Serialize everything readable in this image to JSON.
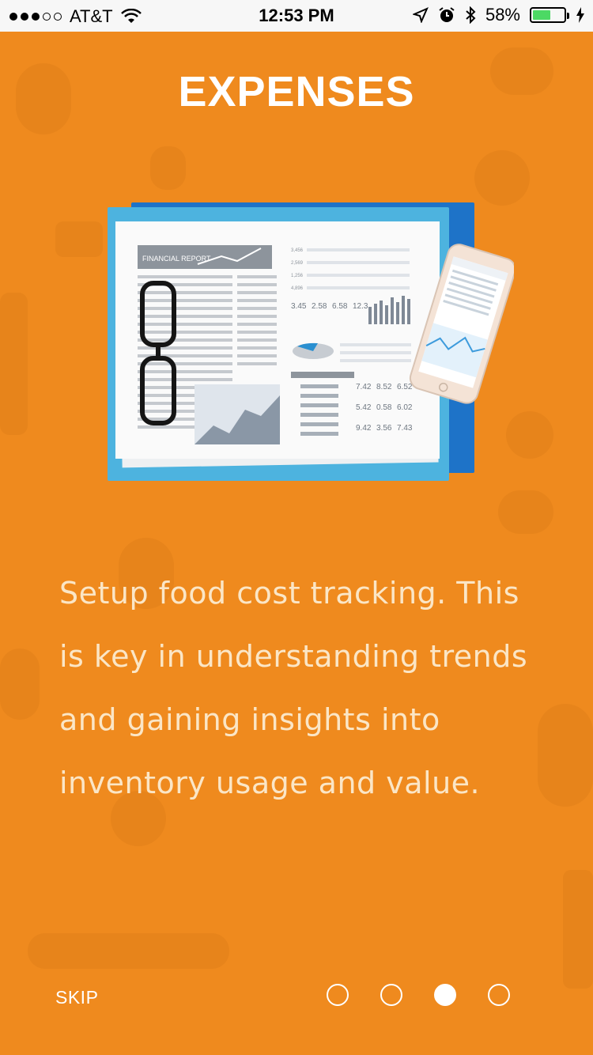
{
  "status_bar": {
    "carrier": "AT&T",
    "time": "12:53 PM",
    "battery_percent": "58%",
    "signal_bars_filled": 3,
    "signal_bars_total": 5,
    "battery_level": 0.58
  },
  "onboarding": {
    "title": "EXPENSES",
    "description": "Setup food cost tracking. This is key in understanding trends and gaining insights into inventory usage and value.",
    "skip_label": "SKIP",
    "pages_total": 4,
    "current_page": 3
  },
  "illustration": {
    "report_title": "FINANCIAL REPORT",
    "row1": [
      "3.45",
      "2.58",
      "6.58",
      "12.3"
    ],
    "table_rows": [
      [
        "7.42",
        "8.52",
        "6.52"
      ],
      [
        "5.42",
        "0.58",
        "6.02"
      ],
      [
        "9.42",
        "3.56",
        "7.43"
      ]
    ],
    "left_values": [
      "3,456",
      "2,569",
      "1,256",
      "4,896"
    ]
  },
  "colors": {
    "background": "#ef8a1e",
    "text_light": "#fbe6c6",
    "battery_fill": "#4cd964"
  }
}
